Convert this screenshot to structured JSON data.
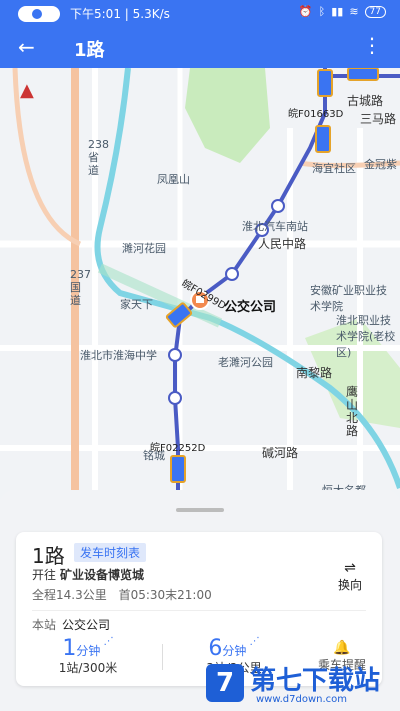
{
  "status_bar": {
    "time": "下午5:01",
    "speed": "5.3K/s",
    "icons": [
      "alarm-icon",
      "bluetooth-icon",
      "signal-icon",
      "wifi-icon"
    ],
    "battery": "77"
  },
  "header": {
    "title": "1路",
    "back_icon": "arrow-left",
    "more_icon": "vertical-dots"
  },
  "map": {
    "labels": {
      "gucheng": "古城路",
      "sanma": "三马路",
      "haiyi": "海宜社区",
      "jincheng": "金冠紫",
      "fenghuang": "凤凰山",
      "qichenan": "淮北汽车南站",
      "renmin": "人民中路",
      "suihe": "濉河花园",
      "anhui": "安徽矿业职业技术学院",
      "huaibeizhiye": "淮北职业技术学院(老校区)",
      "jiatianxia": "家天下",
      "huaihaizhongxue": "淮北市淮海中学",
      "laosuihe": "老濉河公园",
      "nanli": "南黎路",
      "yingshan": "鹰山北路",
      "jianhe": "碱河路",
      "hengdaming": "恒大名都",
      "mingcheng": "铭城",
      "road_238": "238省道",
      "road_237": "237国道"
    },
    "bus_plates": [
      "皖F01663D",
      "皖F02252D",
      "皖F0299D"
    ],
    "current_stop": "公交公司"
  },
  "panel": {
    "route_name": "1路",
    "schedule_label": "发车时刻表",
    "heading_prefix": "开往",
    "destination": "矿业设备博览城",
    "distance": "全程14.3公里",
    "hours": "首05:30末21:00",
    "swap_label": "换向",
    "this_stop_label": "本站",
    "this_stop": "公交公司",
    "arrivals": [
      {
        "minutes": "1",
        "unit": "分钟",
        "sub": "1站/300米"
      },
      {
        "minutes": "6",
        "unit": "分钟",
        "sub": "3站/2公里"
      }
    ],
    "remind_label": "乘车提醒"
  },
  "watermark": {
    "brand": "第七下载站",
    "url": "www.d7down.com",
    "logo": "7"
  },
  "colors": {
    "primary": "#3a74f2",
    "route": "#4a5bc4",
    "river": "#7fd4e4",
    "park": "#c9ebbd"
  }
}
